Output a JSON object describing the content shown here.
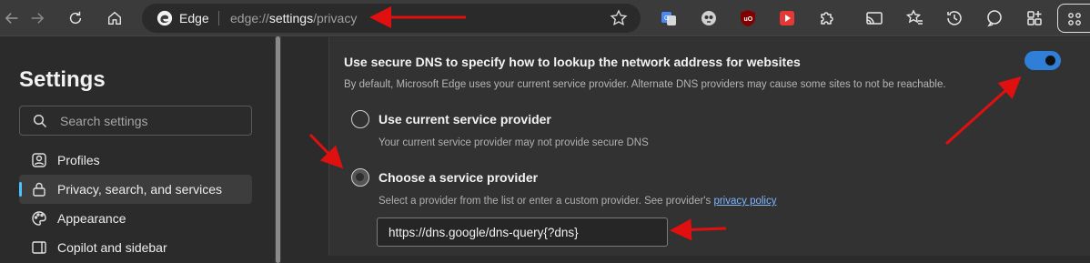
{
  "browser": {
    "address_label": "Edge",
    "url_prefix": "edge://",
    "url_highlight": "settings",
    "url_suffix": "/privacy"
  },
  "sidebar": {
    "title": "Settings",
    "search_placeholder": "Search settings",
    "items": [
      {
        "label": "Profiles",
        "icon": "profile-icon"
      },
      {
        "label": "Privacy, search, and services",
        "icon": "lock-icon",
        "active": true
      },
      {
        "label": "Appearance",
        "icon": "appearance-icon"
      },
      {
        "label": "Copilot and sidebar",
        "icon": "sidebar-icon"
      }
    ]
  },
  "secure_dns": {
    "title": "Use secure DNS to specify how to lookup the network address for websites",
    "description": "By default, Microsoft Edge uses your current service provider. Alternate DNS providers may cause some sites to not be reachable.",
    "enabled": true,
    "options": [
      {
        "label": "Use current service provider",
        "description": "Your current service provider may not provide secure DNS",
        "checked": false
      },
      {
        "label": "Choose a service provider",
        "description": "Select a provider from the list or enter a custom provider. See provider's",
        "link": "privacy policy",
        "checked": true
      }
    ],
    "provider_value": "https://dns.google/dns-query{?dns}"
  },
  "colors": {
    "accent": "#4cc2ff",
    "toggle_on": "#2f7fd8",
    "annotation_arrow": "#e01010"
  }
}
